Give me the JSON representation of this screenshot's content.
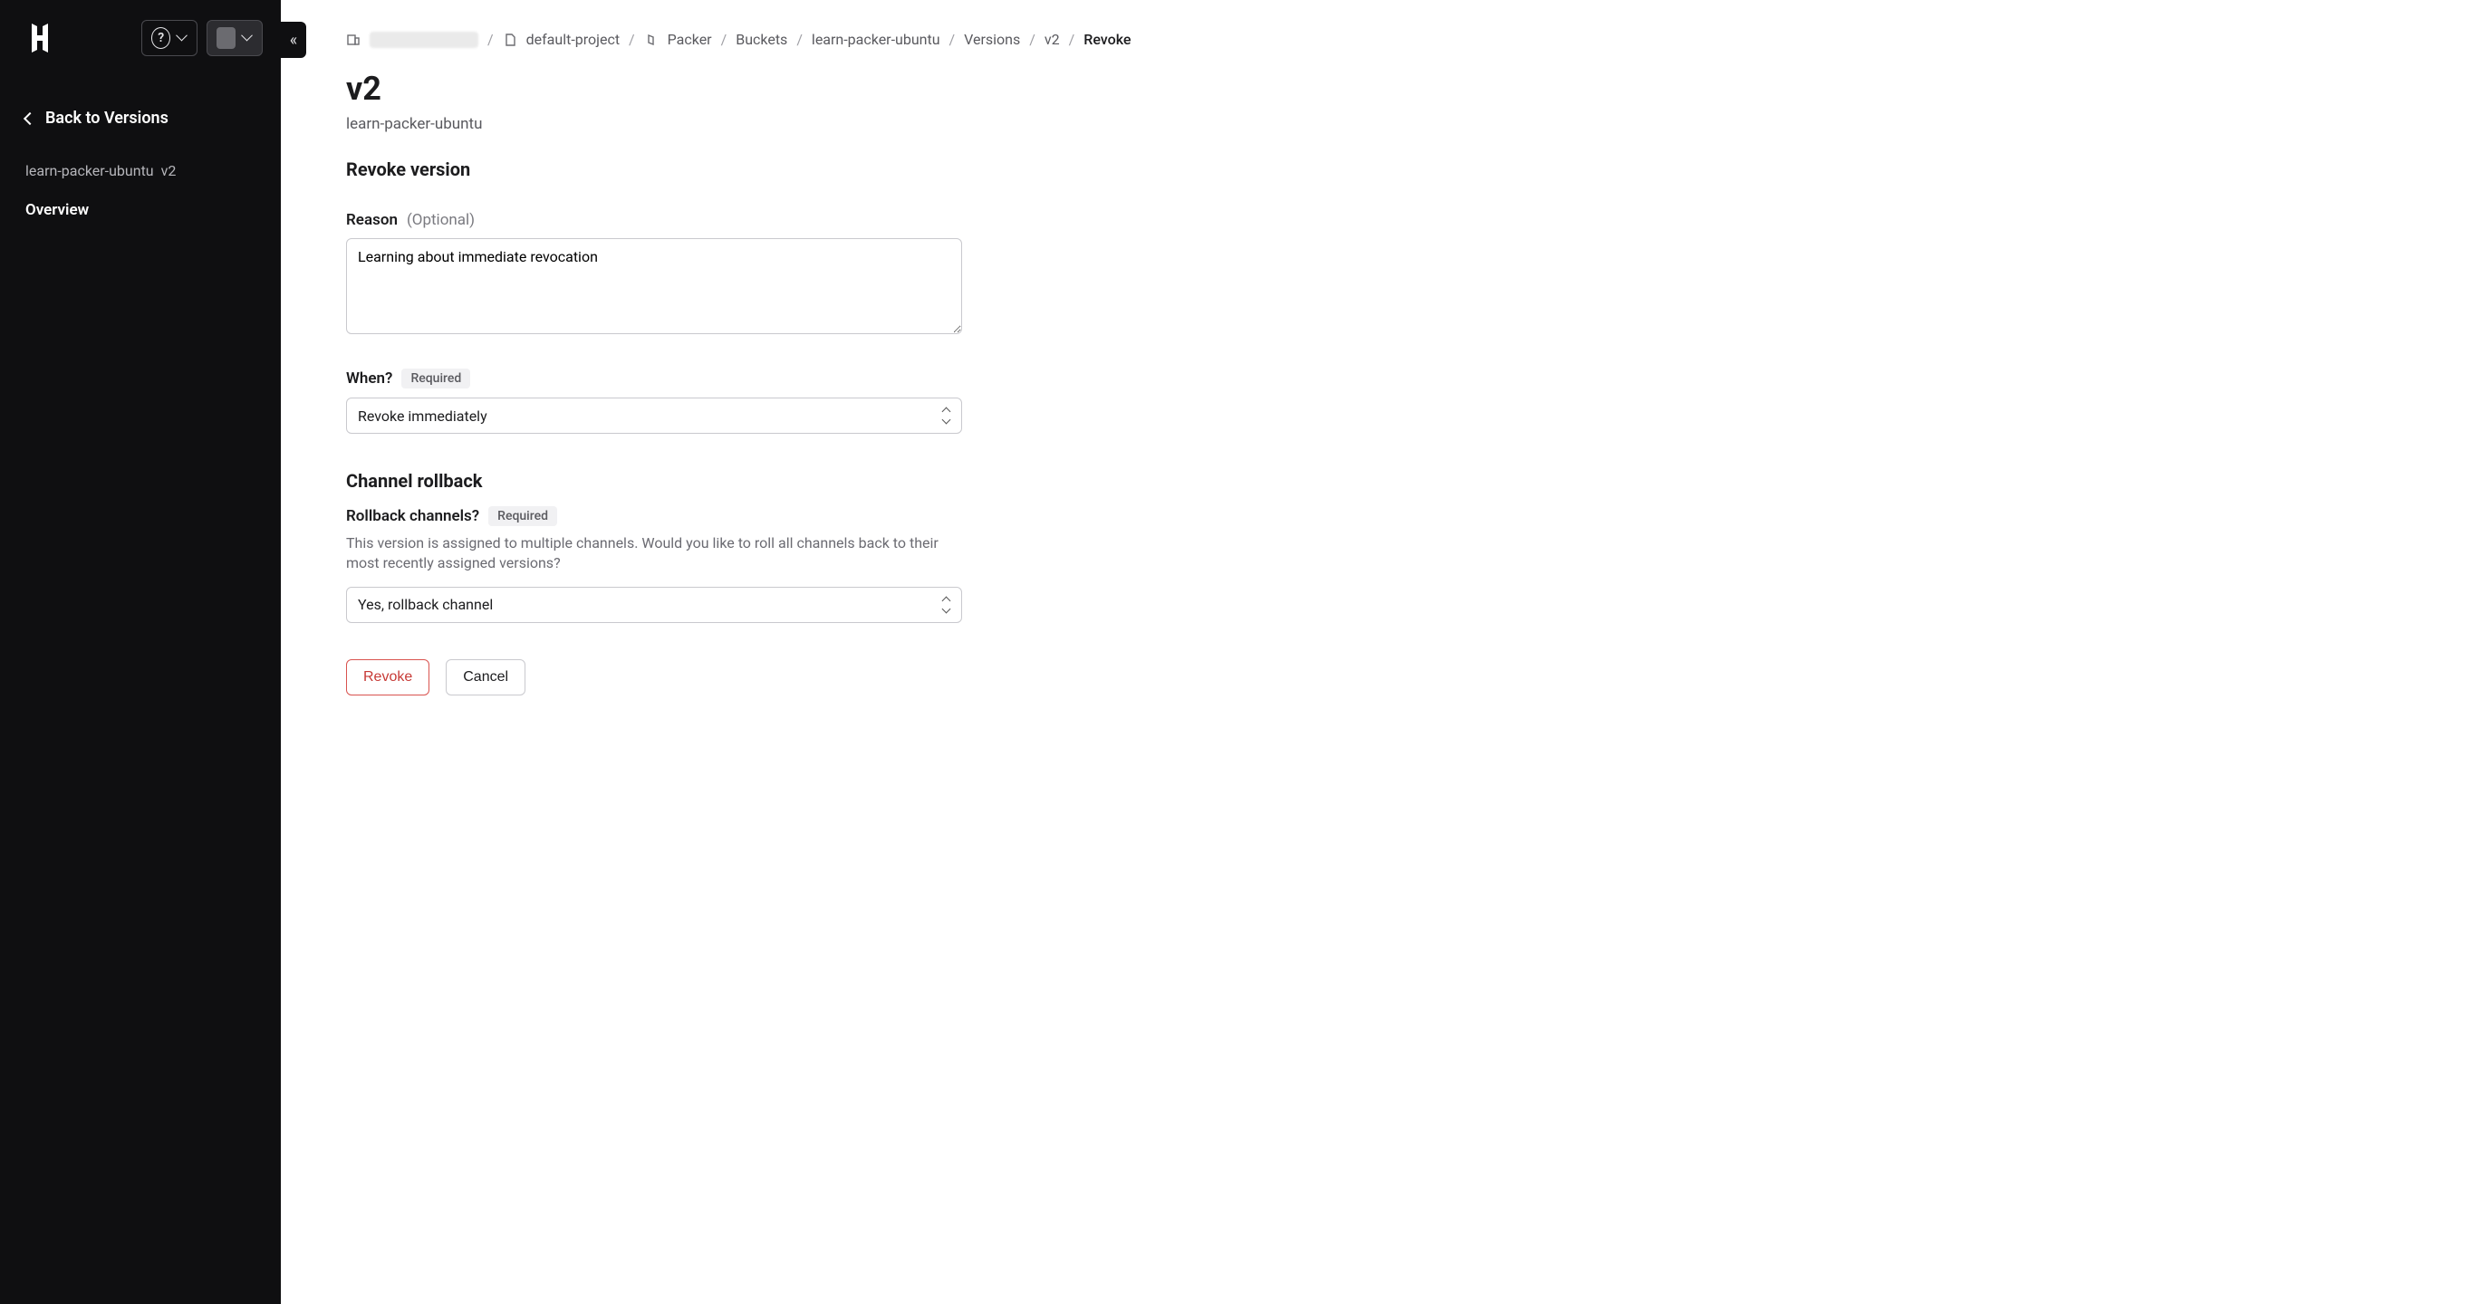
{
  "sidebar": {
    "back_label": "Back to Versions",
    "context_bucket": "learn-packer-ubuntu",
    "context_version": "v2",
    "nav_overview": "Overview"
  },
  "breadcrumb": {
    "project": "default-project",
    "service": "Packer",
    "buckets": "Buckets",
    "bucket": "learn-packer-ubuntu",
    "versions": "Versions",
    "version": "v2",
    "current": "Revoke"
  },
  "header": {
    "title": "v2",
    "subtitle": "learn-packer-ubuntu"
  },
  "form": {
    "section_title": "Revoke version",
    "reason_label": "Reason",
    "reason_hint": "(Optional)",
    "reason_value": "Learning about immediate revocation",
    "when_label": "When?",
    "required_badge": "Required",
    "when_value": "Revoke immediately",
    "rollback_section": "Channel rollback",
    "rollback_label": "Rollback channels?",
    "rollback_help": "This version is assigned to multiple channels. Would you like to roll all channels back to their most recently assigned versions?",
    "rollback_value": "Yes, rollback channel",
    "revoke_btn": "Revoke",
    "cancel_btn": "Cancel"
  }
}
